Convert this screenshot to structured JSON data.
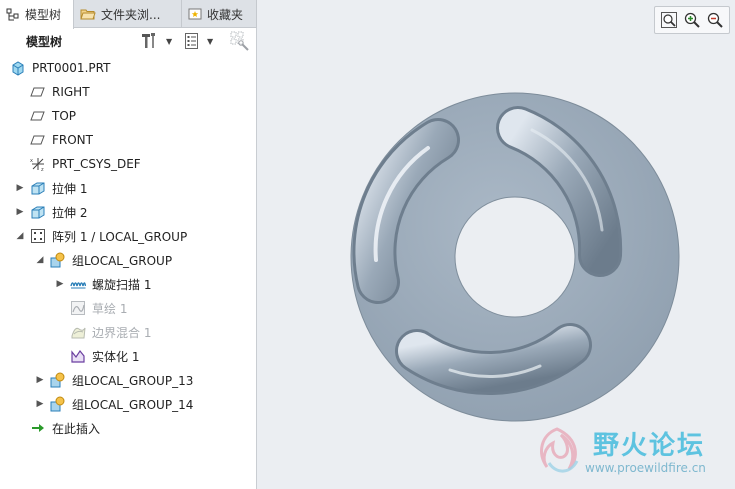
{
  "tabs": [
    {
      "label": "模型树",
      "icon": "tree-icon"
    },
    {
      "label": "文件夹浏...",
      "icon": "folder-icon"
    },
    {
      "label": "收藏夹",
      "icon": "star-icon"
    }
  ],
  "toolbar": {
    "title": "模型树",
    "settings_icon": "hammer-icon",
    "show_icon": "list-icon",
    "filter_icon": "filter-icon"
  },
  "tree": {
    "root": "PRT0001.PRT",
    "items": [
      {
        "label": "RIGHT",
        "icon": "datum-plane-icon"
      },
      {
        "label": "TOP",
        "icon": "datum-plane-icon"
      },
      {
        "label": "FRONT",
        "icon": "datum-plane-icon"
      },
      {
        "label": "PRT_CSYS_DEF",
        "icon": "csys-icon"
      },
      {
        "label": "拉伸 1",
        "icon": "extrude-icon"
      },
      {
        "label": "拉伸 2",
        "icon": "extrude-icon"
      },
      {
        "label": "阵列 1 / LOCAL_GROUP",
        "icon": "pattern-icon"
      },
      {
        "label": "组LOCAL_GROUP",
        "icon": "group-icon"
      },
      {
        "label": "螺旋扫描 1",
        "icon": "helical-sweep-icon"
      },
      {
        "label": "草绘 1",
        "icon": "sketch-icon"
      },
      {
        "label": "边界混合 1",
        "icon": "boundary-blend-icon"
      },
      {
        "label": "实体化 1",
        "icon": "solidify-icon"
      },
      {
        "label": "组LOCAL_GROUP_13",
        "icon": "group-icon"
      },
      {
        "label": "组LOCAL_GROUP_14",
        "icon": "group-icon"
      },
      {
        "label": "在此插入",
        "icon": "insert-arrow-icon"
      }
    ]
  },
  "view_toolbar": [
    "refit-icon",
    "zoom-in-icon",
    "zoom-out-icon"
  ],
  "watermark": {
    "title": "野火论坛",
    "url": "www.proewildfire.cn"
  }
}
